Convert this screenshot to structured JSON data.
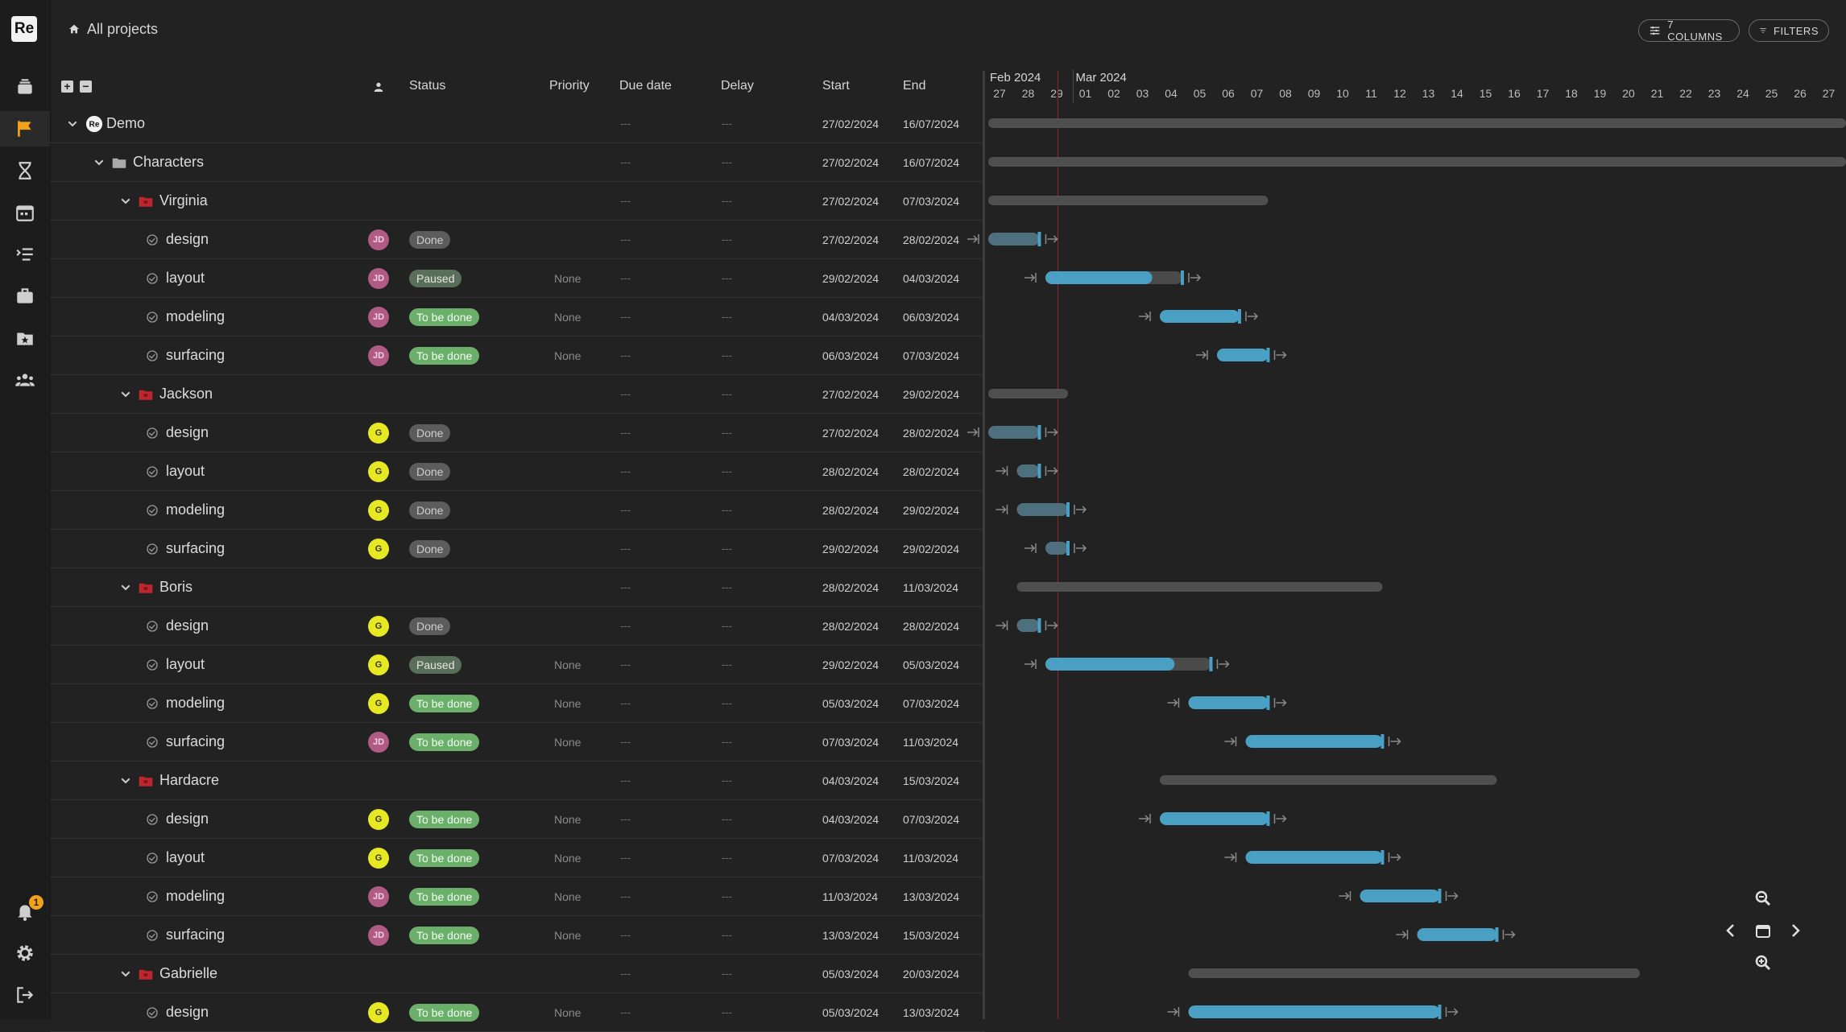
{
  "app": {
    "logo": "Re"
  },
  "colors": {
    "background": "#222222",
    "sidebar": "#1c1c1c",
    "accent_flag": "#f0a31a",
    "bar_blue": "#4a9fc4",
    "bar_gray": "#505050",
    "summary_gray": "#4f4f4f",
    "today_line": "#8a2a2a",
    "status_done": "#5c5c5c",
    "status_paused": "#5a6f5a",
    "status_todo": "#6aaf6a",
    "avatar_jd": "#b05a86",
    "avatar_g": "#e8e822"
  },
  "sidebar": {
    "items": [
      {
        "icon": "productions-icon"
      },
      {
        "icon": "flag-icon",
        "active": true
      },
      {
        "icon": "hourglass-icon"
      },
      {
        "icon": "calendar-icon"
      },
      {
        "icon": "todo-list-icon"
      },
      {
        "icon": "briefcase-icon"
      },
      {
        "icon": "folder-star-icon"
      },
      {
        "icon": "team-icon"
      }
    ],
    "bottom": [
      {
        "icon": "bell-icon",
        "badge": "1"
      },
      {
        "icon": "gear-icon"
      },
      {
        "icon": "logout-icon"
      }
    ]
  },
  "header": {
    "breadcrumb": "All projects",
    "columns_label": "7 COLUMNS",
    "filters_label": "FILTERS"
  },
  "table": {
    "headers": {
      "status": "Status",
      "priority": "Priority",
      "due_date": "Due date",
      "delay": "Delay",
      "start": "Start",
      "end": "End"
    },
    "rows": [
      {
        "type": "project",
        "level": 0,
        "name": "Demo",
        "due": "---",
        "delay": "---",
        "start": "27/02/2024",
        "end": "16/07/2024",
        "gantt": {
          "start": "2024-02-27",
          "end": "2024-07-16"
        }
      },
      {
        "type": "folder",
        "level": 1,
        "name": "Characters",
        "due": "---",
        "delay": "---",
        "start": "27/02/2024",
        "end": "16/07/2024",
        "gantt": {
          "start": "2024-02-27",
          "end": "2024-07-16"
        }
      },
      {
        "type": "asset",
        "level": 2,
        "name": "Virginia",
        "due": "---",
        "delay": "---",
        "start": "27/02/2024",
        "end": "07/03/2024",
        "gantt": {
          "start": "2024-02-27",
          "end": "2024-03-07"
        }
      },
      {
        "type": "task",
        "level": 3,
        "name": "design",
        "assignee": "JD",
        "status": "Done",
        "priority": "",
        "due": "---",
        "delay": "---",
        "start": "27/02/2024",
        "end": "28/02/2024",
        "gantt": {
          "start": "2024-02-27",
          "end": "2024-02-28"
        }
      },
      {
        "type": "task",
        "level": 3,
        "name": "layout",
        "assignee": "JD",
        "status": "Paused",
        "priority": "None",
        "due": "---",
        "delay": "---",
        "start": "29/02/2024",
        "end": "04/03/2024",
        "gantt": {
          "start": "2024-02-29",
          "end": "2024-03-04"
        }
      },
      {
        "type": "task",
        "level": 3,
        "name": "modeling",
        "assignee": "JD",
        "status": "To be done",
        "priority": "None",
        "due": "---",
        "delay": "---",
        "start": "04/03/2024",
        "end": "06/03/2024",
        "gantt": {
          "start": "2024-03-04",
          "end": "2024-03-06"
        }
      },
      {
        "type": "task",
        "level": 3,
        "name": "surfacing",
        "assignee": "JD",
        "status": "To be done",
        "priority": "None",
        "due": "---",
        "delay": "---",
        "start": "06/03/2024",
        "end": "07/03/2024",
        "gantt": {
          "start": "2024-03-06",
          "end": "2024-03-07"
        }
      },
      {
        "type": "asset",
        "level": 2,
        "name": "Jackson",
        "due": "---",
        "delay": "---",
        "start": "27/02/2024",
        "end": "29/02/2024",
        "gantt": {
          "start": "2024-02-27",
          "end": "2024-02-29"
        }
      },
      {
        "type": "task",
        "level": 3,
        "name": "design",
        "assignee": "G",
        "status": "Done",
        "priority": "",
        "due": "---",
        "delay": "---",
        "start": "27/02/2024",
        "end": "28/02/2024",
        "gantt": {
          "start": "2024-02-27",
          "end": "2024-02-28"
        }
      },
      {
        "type": "task",
        "level": 3,
        "name": "layout",
        "assignee": "G",
        "status": "Done",
        "priority": "",
        "due": "---",
        "delay": "---",
        "start": "28/02/2024",
        "end": "28/02/2024",
        "gantt": {
          "start": "2024-02-28",
          "end": "2024-02-28"
        }
      },
      {
        "type": "task",
        "level": 3,
        "name": "modeling",
        "assignee": "G",
        "status": "Done",
        "priority": "",
        "due": "---",
        "delay": "---",
        "start": "28/02/2024",
        "end": "29/02/2024",
        "gantt": {
          "start": "2024-02-28",
          "end": "2024-02-29"
        }
      },
      {
        "type": "task",
        "level": 3,
        "name": "surfacing",
        "assignee": "G",
        "status": "Done",
        "priority": "",
        "due": "---",
        "delay": "---",
        "start": "29/02/2024",
        "end": "29/02/2024",
        "gantt": {
          "start": "2024-02-29",
          "end": "2024-02-29"
        }
      },
      {
        "type": "asset",
        "level": 2,
        "name": "Boris",
        "due": "---",
        "delay": "---",
        "start": "28/02/2024",
        "end": "11/03/2024",
        "gantt": {
          "start": "2024-02-28",
          "end": "2024-03-11"
        }
      },
      {
        "type": "task",
        "level": 3,
        "name": "design",
        "assignee": "G",
        "status": "Done",
        "priority": "",
        "due": "---",
        "delay": "---",
        "start": "28/02/2024",
        "end": "28/02/2024",
        "gantt": {
          "start": "2024-02-28",
          "end": "2024-02-28"
        }
      },
      {
        "type": "task",
        "level": 3,
        "name": "layout",
        "assignee": "G",
        "status": "Paused",
        "priority": "None",
        "due": "---",
        "delay": "---",
        "start": "29/02/2024",
        "end": "05/03/2024",
        "gantt": {
          "start": "2024-02-29",
          "end": "2024-03-05"
        }
      },
      {
        "type": "task",
        "level": 3,
        "name": "modeling",
        "assignee": "G",
        "status": "To be done",
        "priority": "None",
        "due": "---",
        "delay": "---",
        "start": "05/03/2024",
        "end": "07/03/2024",
        "gantt": {
          "start": "2024-03-05",
          "end": "2024-03-07"
        }
      },
      {
        "type": "task",
        "level": 3,
        "name": "surfacing",
        "assignee": "JD",
        "status": "To be done",
        "priority": "None",
        "due": "---",
        "delay": "---",
        "start": "07/03/2024",
        "end": "11/03/2024",
        "gantt": {
          "start": "2024-03-07",
          "end": "2024-03-11"
        }
      },
      {
        "type": "asset",
        "level": 2,
        "name": "Hardacre",
        "due": "---",
        "delay": "---",
        "start": "04/03/2024",
        "end": "15/03/2024",
        "gantt": {
          "start": "2024-03-04",
          "end": "2024-03-15"
        }
      },
      {
        "type": "task",
        "level": 3,
        "name": "design",
        "assignee": "G",
        "status": "To be done",
        "priority": "None",
        "due": "---",
        "delay": "---",
        "start": "04/03/2024",
        "end": "07/03/2024",
        "gantt": {
          "start": "2024-03-04",
          "end": "2024-03-07"
        }
      },
      {
        "type": "task",
        "level": 3,
        "name": "layout",
        "assignee": "G",
        "status": "To be done",
        "priority": "None",
        "due": "---",
        "delay": "---",
        "start": "07/03/2024",
        "end": "11/03/2024",
        "gantt": {
          "start": "2024-03-07",
          "end": "2024-03-11"
        }
      },
      {
        "type": "task",
        "level": 3,
        "name": "modeling",
        "assignee": "JD",
        "status": "To be done",
        "priority": "None",
        "due": "---",
        "delay": "---",
        "start": "11/03/2024",
        "end": "13/03/2024",
        "gantt": {
          "start": "2024-03-11",
          "end": "2024-03-13"
        }
      },
      {
        "type": "task",
        "level": 3,
        "name": "surfacing",
        "assignee": "JD",
        "status": "To be done",
        "priority": "None",
        "due": "---",
        "delay": "---",
        "start": "13/03/2024",
        "end": "15/03/2024",
        "gantt": {
          "start": "2024-03-13",
          "end": "2024-03-15"
        }
      },
      {
        "type": "asset",
        "level": 2,
        "name": "Gabrielle",
        "due": "---",
        "delay": "---",
        "start": "05/03/2024",
        "end": "20/03/2024",
        "gantt": {
          "start": "2024-03-05",
          "end": "2024-03-20"
        }
      },
      {
        "type": "task",
        "level": 3,
        "name": "design",
        "assignee": "G",
        "status": "To be done",
        "priority": "None",
        "due": "---",
        "delay": "---",
        "start": "05/03/2024",
        "end": "13/03/2024",
        "gantt": {
          "start": "2024-03-05",
          "end": "2024-03-13"
        }
      }
    ]
  },
  "gantt": {
    "months": [
      {
        "label": "Feb 2024",
        "first_day": "2024-02-27"
      },
      {
        "label": "Mar 2024",
        "first_day": "2024-03-01"
      }
    ],
    "days": [
      "27",
      "28",
      "29",
      "01",
      "02",
      "03",
      "04",
      "05",
      "06",
      "07",
      "08",
      "09",
      "10",
      "11",
      "12",
      "13",
      "14",
      "15",
      "16",
      "17",
      "18",
      "19",
      "20",
      "21",
      "22",
      "23",
      "24",
      "25",
      "26",
      "27"
    ],
    "first_visible_day": "2024-02-27",
    "today": "2024-02-29"
  }
}
